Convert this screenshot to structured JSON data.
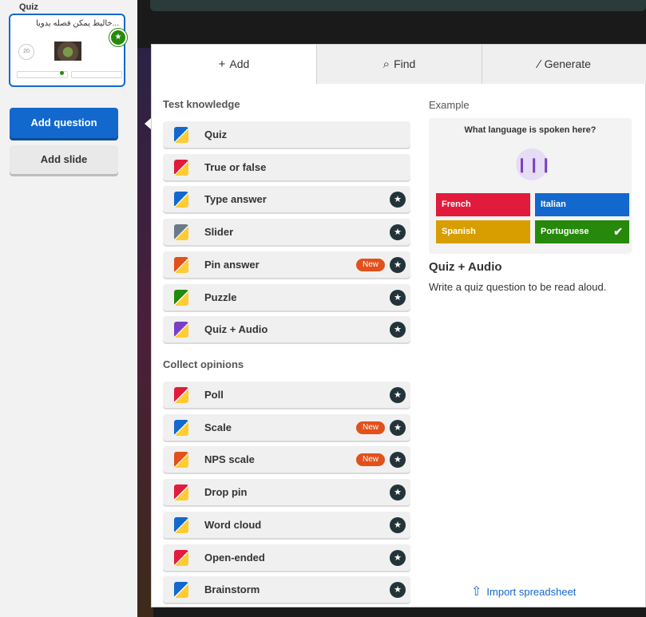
{
  "sidebar": {
    "section_title": "Quiz",
    "thumbnail": {
      "title": "...خاليط يمكن فصله يدويا",
      "timer": "20"
    },
    "add_question_label": "Add question",
    "add_slide_label": "Add slide"
  },
  "tabs": [
    {
      "icon": "plus-icon",
      "label": "Add"
    },
    {
      "icon": "search-icon",
      "label": "Find"
    },
    {
      "icon": "magic-wand-icon",
      "label": "Generate"
    }
  ],
  "test_knowledge": {
    "heading": "Test knowledge",
    "items": [
      {
        "label": "Quiz",
        "icon": "quiz-icon",
        "star": false,
        "new": ""
      },
      {
        "label": "True or false",
        "icon": "true-false-icon",
        "star": false,
        "new": ""
      },
      {
        "label": "Type answer",
        "icon": "type-answer-icon",
        "star": true,
        "new": ""
      },
      {
        "label": "Slider",
        "icon": "slider-icon",
        "star": true,
        "new": ""
      },
      {
        "label": "Pin answer",
        "icon": "pin-answer-icon",
        "star": true,
        "new": "New"
      },
      {
        "label": "Puzzle",
        "icon": "puzzle-icon",
        "star": true,
        "new": ""
      },
      {
        "label": "Quiz + Audio",
        "icon": "quiz-audio-icon",
        "star": true,
        "new": ""
      }
    ]
  },
  "collect_opinions": {
    "heading": "Collect opinions",
    "items": [
      {
        "label": "Poll",
        "icon": "poll-icon",
        "star": true,
        "new": ""
      },
      {
        "label": "Scale",
        "icon": "scale-icon",
        "star": true,
        "new": "New"
      },
      {
        "label": "NPS scale",
        "icon": "nps-scale-icon",
        "star": true,
        "new": "New"
      },
      {
        "label": "Drop pin",
        "icon": "drop-pin-icon",
        "star": true,
        "new": ""
      },
      {
        "label": "Word cloud",
        "icon": "word-cloud-icon",
        "star": true,
        "new": ""
      },
      {
        "label": "Open-ended",
        "icon": "open-ended-icon",
        "star": true,
        "new": ""
      },
      {
        "label": "Brainstorm",
        "icon": "brainstorm-icon",
        "star": true,
        "new": ""
      }
    ]
  },
  "example": {
    "label": "Example",
    "question": "What language is spoken here?",
    "answers": [
      {
        "text": "French",
        "color": "#e21b3c"
      },
      {
        "text": "Italian",
        "color": "#1368ce"
      },
      {
        "text": "Spanish",
        "color": "#d89e00"
      },
      {
        "text": "Portuguese",
        "color": "#26890c",
        "correct": true
      }
    ],
    "title": "Quiz + Audio",
    "description": "Write a quiz question to be read aloud."
  },
  "import_label": "Import spreadsheet",
  "colors": {
    "accent": "#1368ce",
    "star_badge": "#22343a",
    "new_badge": "#e2501c"
  }
}
